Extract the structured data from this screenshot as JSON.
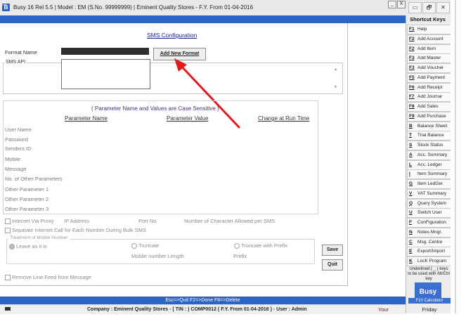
{
  "window": {
    "logo": "B",
    "title": "Busy 16  Rel 5.5  |  Model : EM (S.No. 99999999)  |  Eminent Quality Stores - F.Y. From 01-04-2016",
    "buttons": [
      "▭",
      "🗗",
      "✕"
    ]
  },
  "inner_window": {
    "buttons": [
      "_",
      "X"
    ]
  },
  "form": {
    "title": "SMS Configuration",
    "format_name_label": "Format Name",
    "add_new_format_button": "Add New Format",
    "sms_api_label": "SMS API",
    "param_note": "( Parameter Name and Values are Case Sensitive )",
    "columns": [
      "Parameter Name",
      "Parameter Value",
      "Change at Run Time"
    ],
    "params": [
      "User Name",
      "Password",
      "Senders ID",
      "Mobile",
      "Message",
      "No. of Other Parameters",
      "Other Parameter 1",
      "Other Parameter 2",
      "Other Parameter 3"
    ],
    "internet_via_proxy": "Internet Via Proxy",
    "ip_address": "IP Address",
    "port_no": "Port No.",
    "num_chars": "Number of Character Allowed per SMS",
    "separate_call": "Separate Internet Call for Each Number During Bulk SMS",
    "treatment_label": "Treatment of Mobile Number",
    "leave_as_is": "Leave as it is",
    "truncate": "Truncate",
    "truncate_with_prefix": "Truncate with Prefix",
    "mobile_number_length": "Mobile number Length",
    "prefix": "Prefix",
    "remove_line_feed": "Remove Line Feed from Message",
    "save_button": "Save",
    "quit_button": "Quit"
  },
  "status_bar": "Esc=>Quit   F2=>Done   F8=>Delete",
  "company_bar": {
    "text": "Company : Eminent Quality Stores - ( TIN : ) COMP0012 ( F.Y. From 01-04-2016 ) - User : Admin",
    "your": "Your"
  },
  "shortcuts": {
    "title": "Shortcut Keys",
    "items": [
      {
        "key": "F1",
        "label": "Help"
      },
      {
        "key": "F2",
        "label": "Add Account"
      },
      {
        "key": "F2",
        "label": "Add Item"
      },
      {
        "key": "F3",
        "label": "Add Master"
      },
      {
        "key": "F3",
        "label": "Add Voucher"
      },
      {
        "key": "F5",
        "label": "Add Payment"
      },
      {
        "key": "F6",
        "label": "Add Receipt"
      },
      {
        "key": "F7",
        "label": "Add Journal"
      },
      {
        "key": "F8",
        "label": "Add Sales"
      },
      {
        "key": "F9",
        "label": "Add Purchase"
      },
      {
        "key": "B",
        "label": "Balance Sheet"
      },
      {
        "key": "T",
        "label": "Trial Balance"
      },
      {
        "key": "S",
        "label": "Stock Status"
      },
      {
        "key": "A",
        "label": "Acc. Summary"
      },
      {
        "key": "L",
        "label": "Acc. Ledger"
      },
      {
        "key": "I",
        "label": "Item Summary"
      },
      {
        "key": "G",
        "label": "Item LedGer"
      },
      {
        "key": "V",
        "label": "VAT Summary"
      },
      {
        "key": "Q",
        "label": "Query System"
      },
      {
        "key": "U",
        "label": "Switch User"
      },
      {
        "key": "F",
        "label": "ConFiguration"
      },
      {
        "key": "N",
        "label": "Notes Mngr."
      },
      {
        "key": "C",
        "label": "Msg. Centre"
      },
      {
        "key": "E",
        "label": "Export/Import"
      },
      {
        "key": "K",
        "label": "LocK Program"
      }
    ],
    "note": "Underlined ( _ ) keys to be used with Alt/Ctrl key",
    "logo": "Busy",
    "f10": "F10 Calculator",
    "day": "Friday"
  }
}
